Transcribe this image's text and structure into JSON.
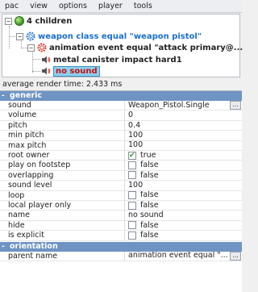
{
  "menu": [
    "pac",
    "view",
    "options",
    "player",
    "tools"
  ],
  "tree": {
    "root": {
      "label": "4 children",
      "expander": "−"
    },
    "child1": {
      "label": "weapon class equal \"weapon pistol\"",
      "expander": "−",
      "color": "#1a6fd0"
    },
    "child2": {
      "label": "animation event equal \"attack primary@...",
      "expander": "−"
    },
    "leaf1": {
      "label": "metal canister impact hard1"
    },
    "leaf2": {
      "label": "no sound"
    }
  },
  "status": "average render time: 2.433 ms",
  "sections": {
    "generic": {
      "title": "generic",
      "mark": "-"
    },
    "orientation": {
      "title": "orientation",
      "mark": "-"
    }
  },
  "ellipsis": "...",
  "properties": [
    {
      "name": "sound",
      "value": "Weapon_Pistol.Single"
    },
    {
      "name": "volume",
      "value": "0"
    },
    {
      "name": "pitch",
      "value": "0.4"
    },
    {
      "name": "min pitch",
      "value": "100"
    },
    {
      "name": "max pitch",
      "value": "100"
    },
    {
      "name": "root owner",
      "value": "true",
      "checked": true
    },
    {
      "name": "play on footstep",
      "value": "false",
      "checked": false
    },
    {
      "name": "overlapping",
      "value": "false",
      "checked": false
    },
    {
      "name": "sound level",
      "value": "100"
    },
    {
      "name": "loop",
      "value": "false",
      "checked": false
    },
    {
      "name": "local player only",
      "value": "false",
      "checked": false
    },
    {
      "name": "name",
      "value": "no sound"
    },
    {
      "name": "hide",
      "value": "false",
      "checked": false
    },
    {
      "name": "is explicit",
      "value": "false",
      "checked": false
    }
  ],
  "orientation_props": [
    {
      "name": "parent name",
      "value": "animation event equal \"..."
    }
  ],
  "colors": {
    "section_header": "#6f94c4",
    "selection": "#8fd0ef",
    "link_blue": "#1a6fd0",
    "gear_red": "#d83a2a"
  }
}
